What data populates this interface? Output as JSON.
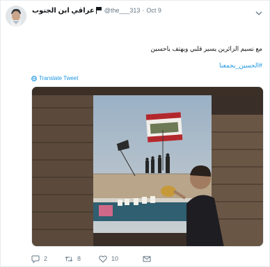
{
  "tweet": {
    "display_name": "عراقي ابن الجنوب",
    "handle": "@the___313",
    "separator": "·",
    "time": "Oct 9",
    "text": "مع نسيم الزائرين يسير قلبي ويهتف ياحسين",
    "hashtag": "#الحسين_يجمعنا",
    "translate_label": "Translate Tweet",
    "media_banner_text": "الحسين يجمعنا"
  },
  "actions": {
    "reply_count": "2",
    "retweet_count": "8",
    "like_count": "10"
  },
  "colors": {
    "link": "#1b95e0",
    "secondary_text": "#657786",
    "border": "#e6ecf0"
  },
  "icons": {
    "avatar": "avatar",
    "flag": "flag-icon",
    "caret": "chevron-down-icon",
    "globe": "globe-icon",
    "reply": "reply-icon",
    "retweet": "retweet-icon",
    "like": "heart-icon",
    "dm": "envelope-icon"
  }
}
